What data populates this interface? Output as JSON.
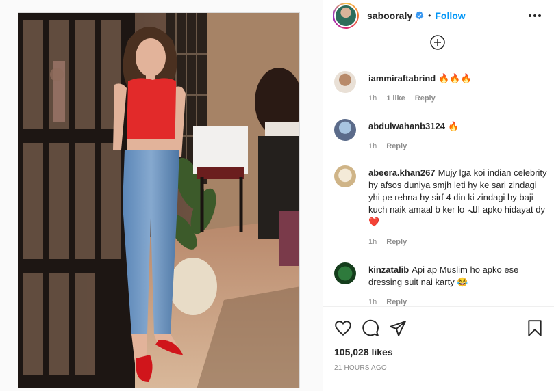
{
  "post": {
    "username": "sabooraly",
    "dot": "•",
    "follow_label": "Follow",
    "likes": "105,028 likes",
    "time_ago": "21 HOURS AGO"
  },
  "comments": [
    {
      "username": "iammiraftabrind",
      "text": "🔥🔥🔥",
      "time": "1h",
      "likes": "1 like",
      "reply": "Reply",
      "avatar_color": "#c9b8a6"
    },
    {
      "username": "abdulwahanb3124",
      "text": "🔥",
      "time": "1h",
      "reply": "Reply",
      "avatar_color": "#5b6b8a"
    },
    {
      "username": "abeera.khan267",
      "text": "Mujy lga koi indian celebrity hy afsos duniya smjh leti hy ke sari zindagi yhi pe rehna hy sirf 4 din ki zindagi hy baji kuch naik amaal b ker lo اللہ apko hidayat dy❤️",
      "time": "1h",
      "reply": "Reply",
      "avatar_color": "#e0c9a0"
    },
    {
      "username": "kinzatalib",
      "text": "Api ap Muslim ho apko ese dressing suit nai karty 😂",
      "time": "1h",
      "reply": "Reply",
      "avatar_color": "#1f5a2a"
    }
  ],
  "colors": {
    "accent": "#0095f6",
    "verified": "#3897f0",
    "muted": "#8e8e8e"
  },
  "icons": [
    "verified-badge-icon",
    "more-options-icon",
    "load-more-comments-icon",
    "heart-icon",
    "comment-icon",
    "share-icon",
    "bookmark-icon"
  ]
}
